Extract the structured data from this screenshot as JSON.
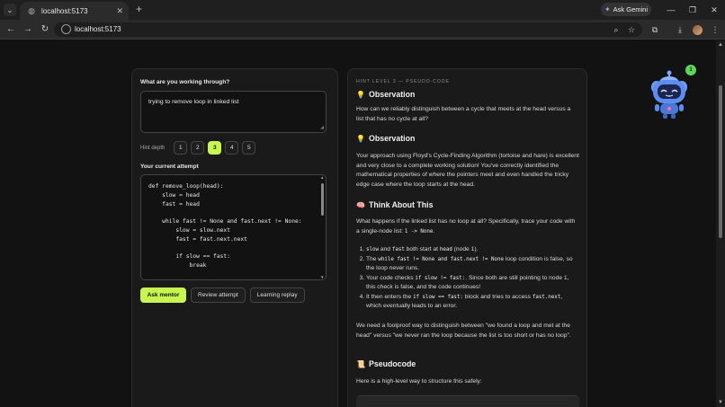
{
  "browser": {
    "tab_title": "localhost:5173",
    "url": "localhost:5173",
    "gemini_label": "Ask Gemini"
  },
  "left": {
    "problem_label": "What are you working through?",
    "problem_value": "trying to remove  loop in linked list",
    "hint_depth_label": "Hint depth",
    "hint_levels": [
      "1",
      "2",
      "3",
      "4",
      "5"
    ],
    "hint_selected": "3",
    "attempt_label": "Your current attempt",
    "code": "def remove_loop(head):\n    slow = head\n    fast = head\n\n    while fast != None and fast.next != None:\n        slow = slow.next\n        fast = fast.next.next\n\n        if slow == fast:\n            break",
    "ask_mentor": "Ask mentor",
    "review_attempt": "Review attempt",
    "learning_replay": "Learning replay"
  },
  "right": {
    "hint_heading": "HINT LEVEL 3 — PSEUDO-CODE",
    "obs1_title": "Observation",
    "obs1_text": "How can we reliably distinguish between a cycle that meets at the head versus a list that has no cycle at all?",
    "obs2_title": "Observation",
    "obs2_text": "Your approach using Floyd's Cycle-Finding Algorithm (tortoise and hare) is excellent and very close to a complete working solution! You've correctly identified the mathematical properties of where the pointers meet and even handled the tricky edge case where the loop starts at the head.",
    "think_title": "Think About This",
    "think_text_a": "What happens if the linked list has no loop at all? Specifically, trace your code with a single-node list: ",
    "think_code": "1 -> None",
    "think_text_b": ".",
    "steps": [
      {
        "pre": "",
        "c1": "slow",
        "mid1": " and ",
        "c2": "fast",
        "mid2": " both start at ",
        "c3": "head",
        "post": " (node 1)."
      },
      {
        "pre": "The ",
        "c1": "while fast != None and fast.next != None",
        "mid1": " loop condition is false, so the loop never runs.",
        "c2": "",
        "mid2": "",
        "c3": "",
        "post": ""
      },
      {
        "pre": "Your code checks ",
        "c1": "if slow != fast:",
        "mid1": ". Since both are still pointing to node 1, this check is false, and the code continues!",
        "c2": "",
        "mid2": "",
        "c3": "",
        "post": ""
      },
      {
        "pre": "It then enters the ",
        "c1": "if slow == fast:",
        "mid1": " block and tries to access ",
        "c2": "fast.next",
        "mid2": ", which eventually leads to an error.",
        "c3": "",
        "post": ""
      }
    ],
    "conclusion": "We need a foolproof way to distinguish between \"we found a loop and met at the head\" versus \"we never ran the loop because the list is too short or has no loop\".",
    "pseudo_title": "Pseudocode",
    "pseudo_intro": "Here is a high-level way to structure this safely:"
  },
  "mascot": {
    "badge": "1"
  },
  "colors": {
    "accent": "#c6f64f",
    "background": "#121212",
    "panel": "#1a1a1a",
    "mascot_blue": "#5b8ef0",
    "badge_green": "#5cd65c"
  }
}
